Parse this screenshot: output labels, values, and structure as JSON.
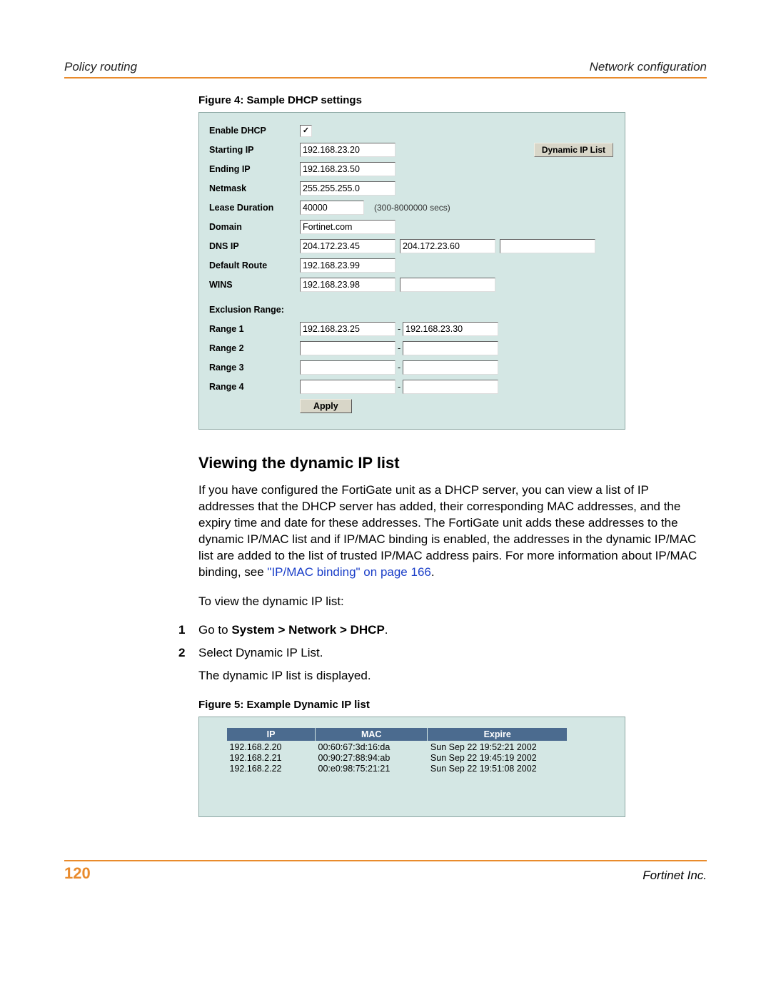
{
  "header": {
    "left": "Policy routing",
    "right": "Network configuration"
  },
  "figure4": {
    "caption": "Figure 4:  Sample DHCP settings"
  },
  "dhcp": {
    "enable_label": "Enable DHCP",
    "enable_checked": "✓",
    "starting_ip_label": "Starting IP",
    "starting_ip": "192.168.23.20",
    "ending_ip_label": "Ending IP",
    "ending_ip": "192.168.23.50",
    "netmask_label": "Netmask",
    "netmask": "255.255.255.0",
    "lease_label": "Lease Duration",
    "lease": "40000",
    "lease_hint": "(300-8000000 secs)",
    "domain_label": "Domain",
    "domain": "Fortinet.com",
    "dns_label": "DNS IP",
    "dns1": "204.172.23.45",
    "dns2": "204.172.23.60",
    "dns3": "",
    "default_route_label": "Default Route",
    "default_route": "192.168.23.99",
    "wins_label": "WINS",
    "wins1": "192.168.23.98",
    "wins2": "",
    "exclusion_label": "Exclusion Range:",
    "range1_label": "Range 1",
    "range1_from": "192.168.23.25",
    "range1_to": "192.168.23.30",
    "range2_label": "Range 2",
    "range2_from": "",
    "range2_to": "",
    "range3_label": "Range 3",
    "range3_from": "",
    "range3_to": "",
    "range4_label": "Range 4",
    "range4_from": "",
    "range4_to": "",
    "dynamic_ip_btn": "Dynamic IP List",
    "apply_btn": "Apply"
  },
  "section": {
    "heading": "Viewing the dynamic IP list",
    "para1a": "If you have configured the FortiGate unit as a DHCP server, you can view a list of IP addresses that the DHCP server has added, their corresponding MAC addresses, and the expiry time and date for these addresses. The FortiGate unit adds these addresses to the dynamic IP/MAC list and if IP/MAC binding is enabled, the addresses in the dynamic IP/MAC list are added to the list of trusted IP/MAC address pairs. For more information about IP/MAC binding, see ",
    "link": "\"IP/MAC binding\" on page 166",
    "para1b": ".",
    "para2": "To view the dynamic IP list:",
    "step1_num": "1",
    "step1a": "Go to ",
    "step1b": "System > Network > DHCP",
    "step1c": ".",
    "step2_num": "2",
    "step2": "Select Dynamic IP List.",
    "step2_after": "The dynamic IP list is displayed."
  },
  "figure5": {
    "caption": "Figure 5:  Example Dynamic IP list"
  },
  "iptable": {
    "head_ip": "IP",
    "head_mac": "MAC",
    "head_expire": "Expire",
    "rows": [
      {
        "ip": "192.168.2.20",
        "mac": "00:60:67:3d:16:da",
        "exp": "Sun Sep 22 19:52:21 2002"
      },
      {
        "ip": "192.168.2.21",
        "mac": "00:90:27:88:94:ab",
        "exp": "Sun Sep 22 19:45:19 2002"
      },
      {
        "ip": "192.168.2.22",
        "mac": "00:e0:98:75:21:21",
        "exp": "Sun Sep 22 19:51:08 2002"
      }
    ]
  },
  "footer": {
    "page": "120",
    "right": "Fortinet Inc."
  }
}
